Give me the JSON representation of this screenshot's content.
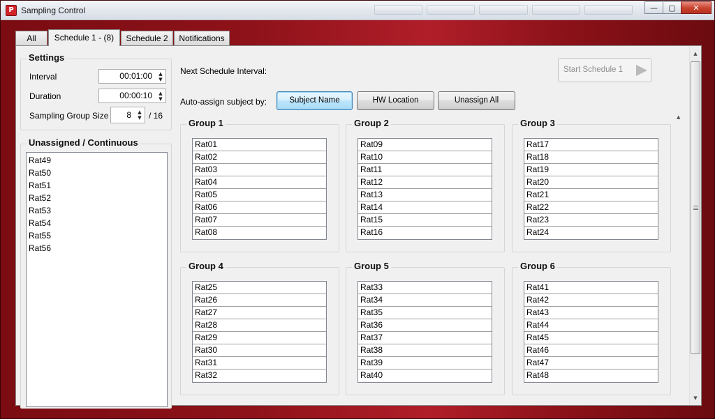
{
  "window": {
    "title": "Sampling Control",
    "icon_text": "P",
    "minimize": "—",
    "maximize": "▢",
    "close": "✕"
  },
  "tabs": [
    "All",
    "Schedule 1 - (8)",
    "Schedule 2",
    "Notifications"
  ],
  "active_tab": 1,
  "settings": {
    "title": "Settings",
    "interval_label": "Interval",
    "interval_value": "00:01:00",
    "duration_label": "Duration",
    "duration_value": "00:00:10",
    "group_size_label": "Sampling Group Size",
    "group_size_value": "8",
    "group_size_max": "/ 16"
  },
  "unassigned": {
    "title": "Unassigned / Continuous",
    "items": [
      "Rat49",
      "Rat50",
      "Rat51",
      "Rat52",
      "Rat53",
      "Rat54",
      "Rat55",
      "Rat56"
    ]
  },
  "schedule": {
    "next_interval_label": "Next Schedule Interval:",
    "start_button": "Start Schedule 1",
    "auto_assign_label": "Auto-assign subject by:",
    "subject_name_button": "Subject Name",
    "hw_location_button": "HW Location",
    "unassign_all_button": "Unassign All"
  },
  "groups": [
    {
      "title": "Group 1",
      "items": [
        "Rat01",
        "Rat02",
        "Rat03",
        "Rat04",
        "Rat05",
        "Rat06",
        "Rat07",
        "Rat08"
      ]
    },
    {
      "title": "Group 2",
      "items": [
        "Rat09",
        "Rat10",
        "Rat11",
        "Rat12",
        "Rat13",
        "Rat14",
        "Rat15",
        "Rat16"
      ]
    },
    {
      "title": "Group 3",
      "items": [
        "Rat17",
        "Rat18",
        "Rat19",
        "Rat20",
        "Rat21",
        "Rat22",
        "Rat23",
        "Rat24"
      ]
    },
    {
      "title": "Group 4",
      "items": [
        "Rat25",
        "Rat26",
        "Rat27",
        "Rat28",
        "Rat29",
        "Rat30",
        "Rat31",
        "Rat32"
      ]
    },
    {
      "title": "Group 5",
      "items": [
        "Rat33",
        "Rat34",
        "Rat35",
        "Rat36",
        "Rat37",
        "Rat38",
        "Rat39",
        "Rat40"
      ]
    },
    {
      "title": "Group 6",
      "items": [
        "Rat41",
        "Rat42",
        "Rat43",
        "Rat44",
        "Rat45",
        "Rat46",
        "Rat47",
        "Rat48"
      ]
    }
  ],
  "colors": {
    "frame": "#8e1219",
    "accent_highlight": "#b01e29",
    "client_bg": "#f0f0f0"
  }
}
